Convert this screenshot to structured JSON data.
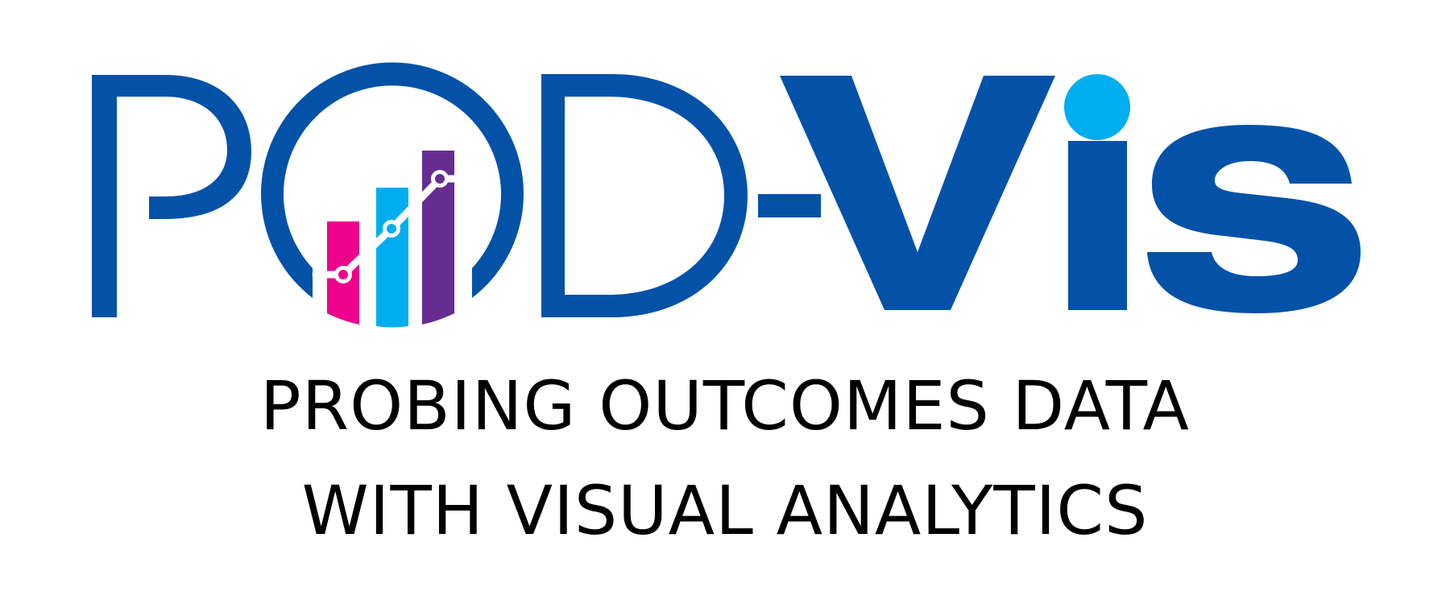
{
  "logo": {
    "wordmark": "POD-Vis",
    "colors": {
      "brand_blue": "#0352a8",
      "accent_cyan": "#00aeef",
      "accent_magenta": "#ec008c",
      "accent_purple": "#662d91",
      "text_black": "#000000",
      "background": "#ffffff"
    },
    "icons": {
      "o_letter": "bar-chart-icon",
      "i_dot": "circle-dot-icon"
    }
  },
  "tagline": {
    "line1": "PROBING OUTCOMES DATA",
    "line2": "WITH VISUAL ANALYTICS"
  }
}
